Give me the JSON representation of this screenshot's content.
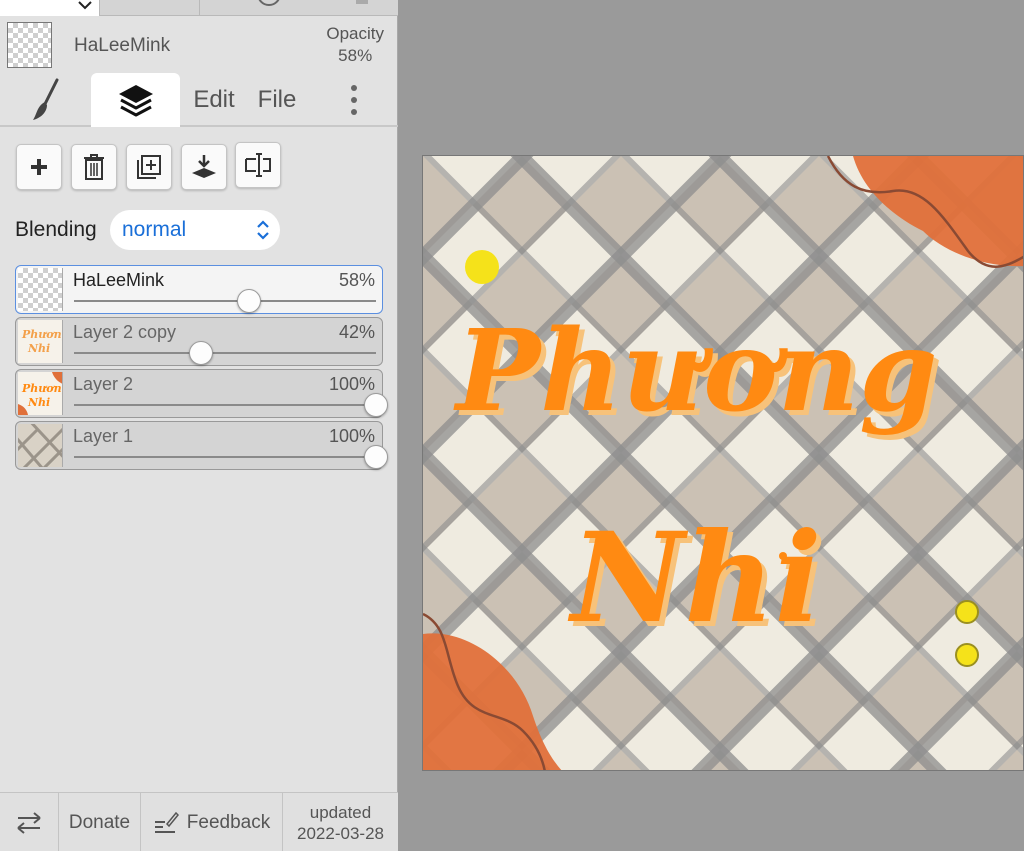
{
  "header": {
    "layer_name": "HaLeeMink",
    "opacity_label": "Opacity",
    "opacity_value": "58%"
  },
  "tabs": {
    "brush_icon": "brush-icon",
    "layers_icon": "layers-icon",
    "edit": "Edit",
    "file": "File",
    "more_icon": "more-vertical-icon"
  },
  "toolbar": {
    "icons": [
      "plus-icon",
      "trash-icon",
      "duplicate-layer-icon",
      "merge-down-icon",
      "text-cursor-icon"
    ]
  },
  "blending": {
    "label": "Blending",
    "value": "normal"
  },
  "layers": [
    {
      "name": "HaLeeMink",
      "opacity_label": "58%",
      "opacity": 0.58,
      "selected": true
    },
    {
      "name": "Layer 2 copy",
      "opacity_label": "42%",
      "opacity": 0.42,
      "selected": false
    },
    {
      "name": "Layer 2",
      "opacity_label": "100%",
      "opacity": 1.0,
      "selected": false
    },
    {
      "name": "Layer 1",
      "opacity_label": "100%",
      "opacity": 1.0,
      "selected": false
    }
  ],
  "footer": {
    "swap_icon": "swap-arrows-icon",
    "donate": "Donate",
    "feedback": "Feedback",
    "updated_label": "updated",
    "updated_date": "2022-03-28"
  },
  "canvas": {
    "line1": "Phương",
    "line2": "Nhi"
  },
  "colors": {
    "accent": "#1a6fd8",
    "selected_border": "#5b8fe0",
    "title_orange": "#ff8a12",
    "blob_orange": "#e0703a"
  }
}
